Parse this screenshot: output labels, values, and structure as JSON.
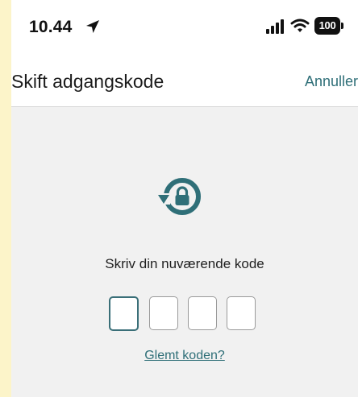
{
  "status_bar": {
    "time": "10.44",
    "battery": "100",
    "icons": [
      "location-arrow-icon",
      "cellular-signal-icon",
      "wifi-icon",
      "battery-icon"
    ]
  },
  "nav": {
    "title": "Skift adgangskode",
    "cancel_label": "Annuller"
  },
  "main": {
    "icon": "reset-lock-icon",
    "prompt": "Skriv din nuværende kode",
    "pin_length": 4,
    "pin_digits": [
      "",
      "",
      "",
      ""
    ],
    "forgot_label": "Glemt koden?"
  },
  "colors": {
    "accent": "#2f6f78",
    "background": "#f1f1f1",
    "frame": "#fcf4c9"
  }
}
